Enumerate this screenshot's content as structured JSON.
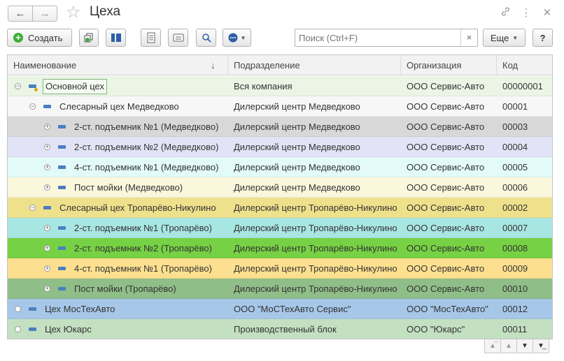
{
  "window": {
    "title": "Цеха"
  },
  "toolbar": {
    "create_label": "Создать",
    "more_label": "Еще",
    "help_label": "?"
  },
  "search": {
    "placeholder": "Поиск (Ctrl+F)",
    "value": ""
  },
  "table": {
    "columns": [
      "Наименование",
      "Подразделение",
      "Организация",
      "Код"
    ],
    "sort_column": "Наименование",
    "sort_direction": "descending-arrow",
    "rows": [
      {
        "name": "Основной цех",
        "dept": "Вся компания",
        "org": "ООО Сервис-Авто",
        "code": "00000001",
        "level": 0,
        "expander": "minus",
        "bg": "#eaf5e6",
        "selected": true
      },
      {
        "name": "Слесарный цех Медведково",
        "dept": "Дилерский центр Медведково",
        "org": "ООО Сервис-Авто",
        "code": "00001",
        "level": 1,
        "expander": "minus",
        "bg": "#f7f7f7"
      },
      {
        "name": "2-ст. подъемник №1 (Медведково)",
        "dept": "Дилерский центр Медведково",
        "org": "ООО Сервис-Авто",
        "code": "00003",
        "level": 2,
        "expander": "plus",
        "bg": "#d8d8d8"
      },
      {
        "name": "2-ст. подъемник №2 (Медведково)",
        "dept": "Дилерский центр Медведково",
        "org": "ООО Сервис-Авто",
        "code": "00004",
        "level": 2,
        "expander": "plus",
        "bg": "#e3e3f7"
      },
      {
        "name": "4-ст. подъемник №1 (Медведково)",
        "dept": "Дилерский центр Медведково",
        "org": "ООО Сервис-Авто",
        "code": "00005",
        "level": 2,
        "expander": "plus",
        "bg": "#e2fbf9"
      },
      {
        "name": "Пост мойки (Медведково)",
        "dept": "Дилерский центр Медведково",
        "org": "ООО Сервис-Авто",
        "code": "00006",
        "level": 2,
        "expander": "plus",
        "bg": "#fbf7dc"
      },
      {
        "name": "Слесарный цех Тропарёво-Никулино",
        "dept": "Дилерский центр Тропарёво-Никулино",
        "org": "ООО Сервис-Авто",
        "code": "00002",
        "level": 1,
        "expander": "minus",
        "bg": "#efe18c"
      },
      {
        "name": "2-ст. подъемник №1 (Тропарёво)",
        "dept": "Дилерский центр Тропарёво-Никулино",
        "org": "ООО Сервис-Авто",
        "code": "00007",
        "level": 2,
        "expander": "plus",
        "bg": "#a8e6e2"
      },
      {
        "name": "2-ст. подъемник №2 (Тропарёво)",
        "dept": "Дилерский центр Тропарёво-Никулино",
        "org": "ООО Сервис-Авто",
        "code": "00008",
        "level": 2,
        "expander": "plus",
        "bg": "#77d144"
      },
      {
        "name": "4-ст. подъемник №1 (Тропарёво)",
        "dept": "Дилерский центр Тропарёво-Никулино",
        "org": "ООО Сервис-Авто",
        "code": "00009",
        "level": 2,
        "expander": "plus",
        "bg": "#fde08f"
      },
      {
        "name": "Пост мойки (Тропарёво)",
        "dept": "Дилерский центр Тропарёво-Никулино",
        "org": "ООО Сервис-Авто",
        "code": "00010",
        "level": 2,
        "expander": "plus",
        "bg": "#90be88"
      },
      {
        "name": "Цех МосТехАвто",
        "dept": "ООО \"МоСТехАвто Сервис\"",
        "org": "ООО \"МосТехАвто\"",
        "code": "00012",
        "level": 0,
        "expander": "circle",
        "bg": "#a6c7e8"
      },
      {
        "name": "Цех Юкарс",
        "dept": "Производственный блок",
        "org": "ООО \"Юкарс\"",
        "code": "00011",
        "level": 0,
        "expander": "circle",
        "bg": "#c3e0c1"
      }
    ]
  },
  "icons": {
    "back": "arrow-left-icon",
    "forward": "arrow-right-icon",
    "favorite": "star-icon",
    "link": "link-icon",
    "menu": "more-vertical-icon",
    "close": "close-icon"
  },
  "colors": {
    "create_accent": "#3fae3a",
    "item_marker": "#4a7fbf"
  }
}
